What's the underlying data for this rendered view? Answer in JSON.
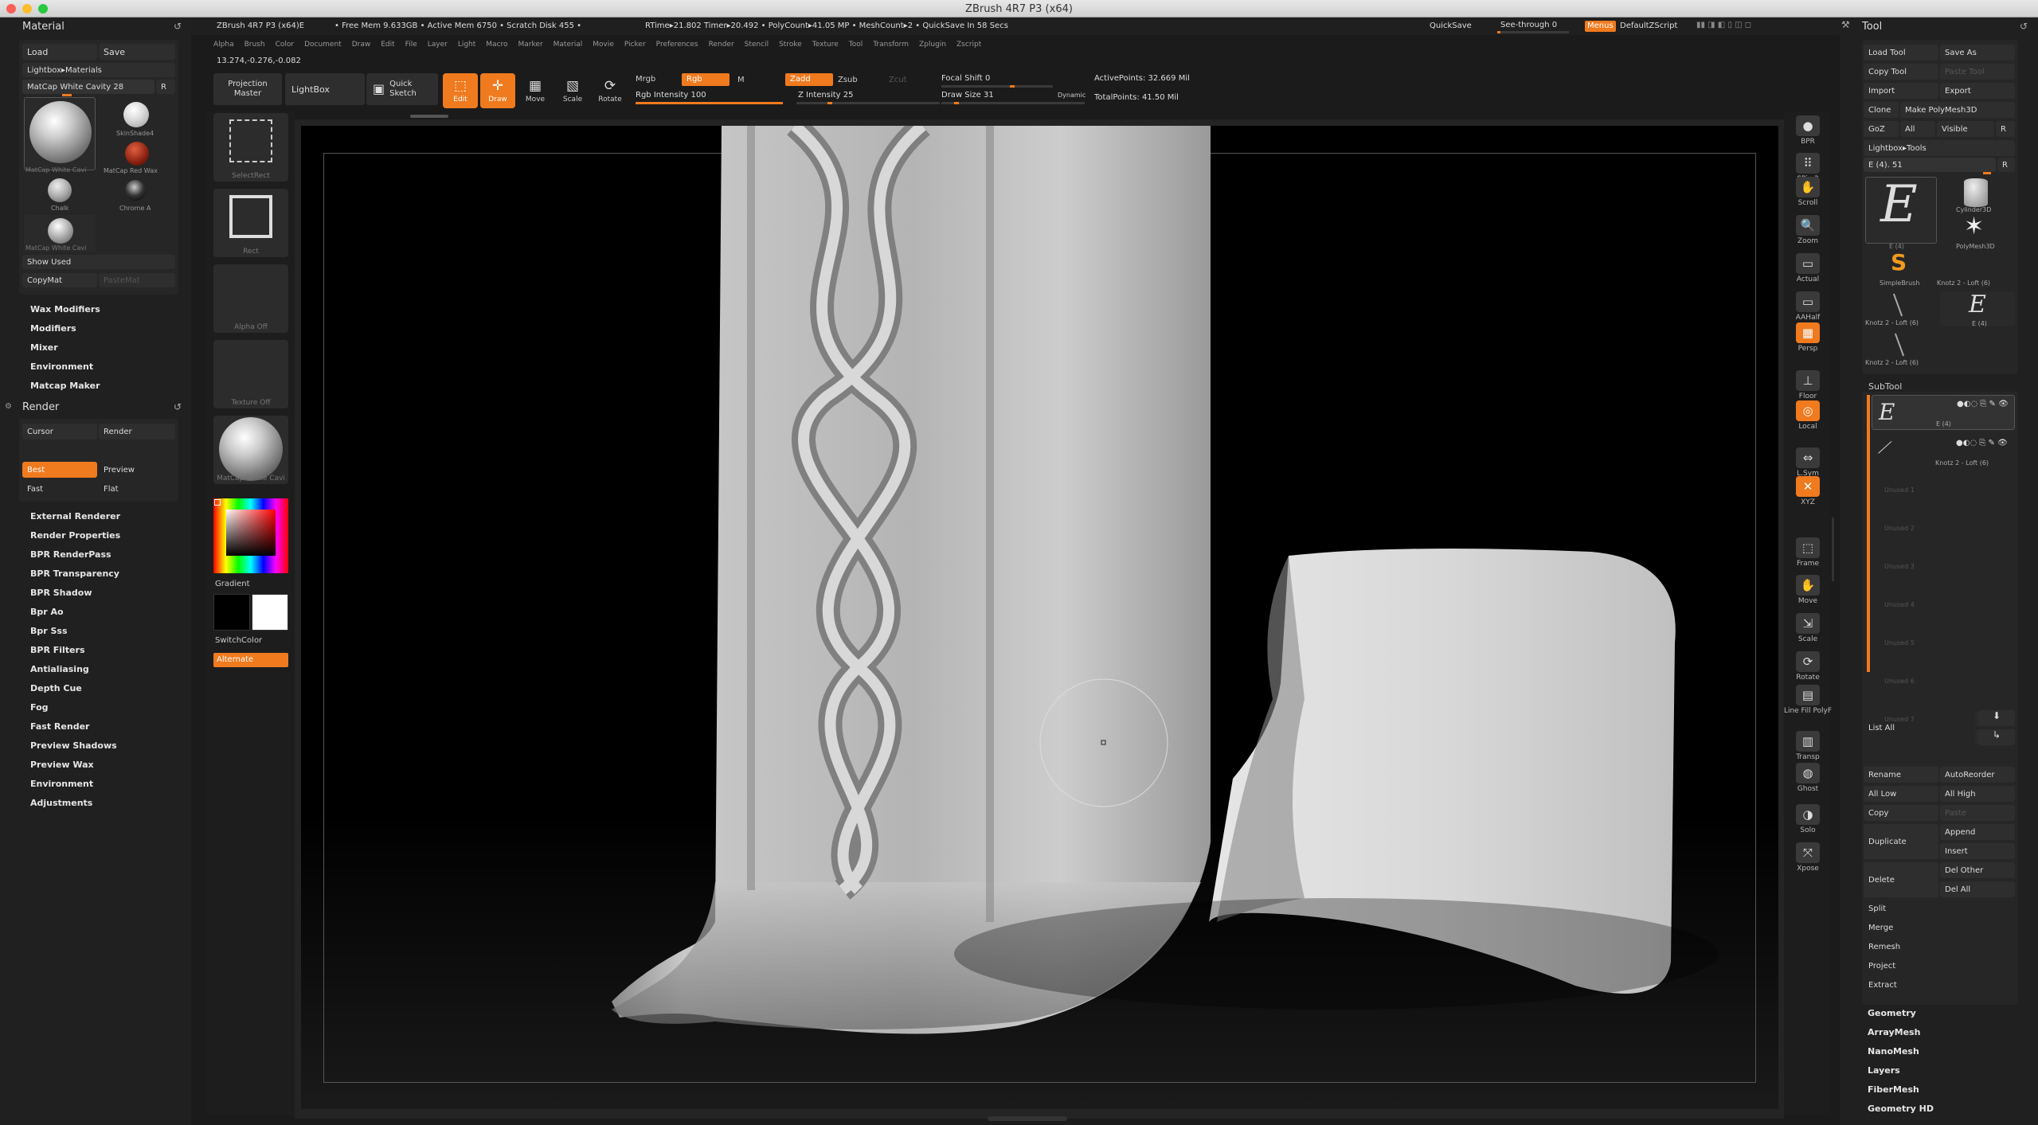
{
  "window": {
    "title": "ZBrush 4R7 P3 (x64)"
  },
  "status_bar": {
    "app": "ZBrush 4R7 P3 (x64)E",
    "free_mem": "• Free Mem 9.633GB • Active Mem 6750 • Scratch Disk 455 •",
    "rtime": "RTime▸21.802 Timer▸20.492 • PolyCount▸41.05 MP • MeshCount▸2 • QuickSave In 58 Secs",
    "quicksave": "QuickSave",
    "see_through": "See-through 0",
    "menus": "Menus",
    "default_zscript": "DefaultZScript"
  },
  "menubar": [
    "Alpha",
    "Brush",
    "Color",
    "Document",
    "Draw",
    "Edit",
    "File",
    "Layer",
    "Light",
    "Macro",
    "Marker",
    "Material",
    "Movie",
    "Picker",
    "Preferences",
    "Render",
    "Stencil",
    "Stroke",
    "Texture",
    "Tool",
    "Transform",
    "Zplugin",
    "Zscript"
  ],
  "coords": "13.274,-0.276,-0.082",
  "toolbar": {
    "projection_master": "Projection\nMaster",
    "lightbox": "LightBox",
    "quick_sketch": "Quick\nSketch",
    "edit": "Edit",
    "draw": "Draw",
    "move": "Move",
    "scale": "Scale",
    "rotate": "Rotate",
    "mrgb": "Mrgb",
    "rgb": "Rgb",
    "m": "M",
    "rgb_intensity": "Rgb Intensity 100",
    "zadd": "Zadd",
    "zsub": "Zsub",
    "zcut": "Zcut",
    "z_intensity": "Z Intensity 25",
    "focal_shift": "Focal Shift 0",
    "draw_size": "Draw Size 31",
    "dynamic": "Dynamic",
    "active_points": "ActivePoints: 32.669 Mil",
    "total_points": "TotalPoints: 41.50 Mil",
    "rgb_intensity_value": 100,
    "z_intensity_value": 25,
    "draw_size_value": 31
  },
  "material_panel": {
    "title": "Material",
    "load": "Load",
    "save": "Save",
    "lightbox_materials": "Lightbox▸Materials",
    "current": "MatCap White Cavity 28",
    "r": "R",
    "items": [
      "MatCap White Cavi",
      "SkinShade4",
      "MatCap Red Wax",
      "Chalk",
      "Chrome A",
      "MatCap White Cavi"
    ],
    "show_used": "Show Used",
    "copymat": "CopyMat",
    "pastemat": "PasteMat",
    "sub_menus": [
      "Wax Modifiers",
      "Modifiers",
      "Mixer",
      "Environment",
      "Matcap Maker"
    ]
  },
  "render_panel": {
    "title": "Render",
    "cursor": "Cursor",
    "render": "Render",
    "best": "Best",
    "preview": "Preview",
    "fast": "Fast",
    "flat": "Flat",
    "sub_menus": [
      "External Renderer",
      "Render Properties",
      "BPR RenderPass",
      "BPR Transparency",
      "BPR Shadow",
      "Bpr Ao",
      "Bpr Sss",
      "BPR Filters",
      "Antialiasing",
      "Depth Cue",
      "Fog",
      "Fast Render",
      "Preview Shadows",
      "Preview Wax",
      "Environment",
      "Adjustments"
    ]
  },
  "shelf": {
    "select_rect": "SelectRect",
    "rect": "Rect",
    "alpha_off": "Alpha Off",
    "texture_off": "Texture Off",
    "matcap": "MatCap White Cavi",
    "gradient": "Gradient",
    "switch_color": "SwitchColor",
    "alternate": "Alternate"
  },
  "right_shelf": [
    {
      "label": "BPR",
      "active": false
    },
    {
      "label": "SPix 3",
      "active": false
    },
    {
      "label": "Scroll",
      "active": false
    },
    {
      "label": "Zoom",
      "active": false
    },
    {
      "label": "Actual",
      "active": false
    },
    {
      "label": "AAHalf",
      "active": false
    },
    {
      "label": "Persp",
      "active": true
    },
    {
      "label": "Floor",
      "active": false
    },
    {
      "label": "Local",
      "active": true
    },
    {
      "label": "L.Sym",
      "active": false
    },
    {
      "label": "XYZ",
      "active": true
    },
    {
      "label": "Frame",
      "active": false
    },
    {
      "label": "Move",
      "active": false
    },
    {
      "label": "Scale",
      "active": false
    },
    {
      "label": "Rotate",
      "active": false
    },
    {
      "label": "Line Fill PolyF",
      "active": false
    },
    {
      "label": "Transp",
      "active": false
    },
    {
      "label": "Ghost",
      "active": false
    },
    {
      "label": "Solo",
      "active": false
    },
    {
      "label": "Xpose",
      "active": false
    }
  ],
  "tool_panel": {
    "title": "Tool",
    "load_tool": "Load Tool",
    "save_as": "Save As",
    "copy_tool": "Copy Tool",
    "paste_tool": "Paste Tool",
    "import": "Import",
    "export": "Export",
    "clone": "Clone",
    "make_polymesh": "Make PolyMesh3D",
    "goz": "GoZ",
    "all": "All",
    "visible": "Visible",
    "r": "R",
    "lightbox_tools": "Lightbox▸Tools",
    "current_tool": "E (4). 51",
    "thumbs": [
      "E (4)",
      "Cylinder3D",
      "PolyMesh3D",
      "SimpleBrush",
      "Knotz 2 - Loft (6)",
      "Knotz 2 - Loft (6)",
      "E (4)",
      "Knotz 2 - Loft (6)"
    ],
    "subtool_title": "SubTool",
    "subtools": [
      "E (4)",
      "Knotz 2 - Loft (6)",
      "Unused 1",
      "Unused 2",
      "Unused 3",
      "Unused 4",
      "Unused 5",
      "Unused 6",
      "Unused 7"
    ],
    "list_all": "List All",
    "rename": "Rename",
    "autoreorder": "AutoReorder",
    "all_low": "All Low",
    "all_high": "All High",
    "copy": "Copy",
    "paste": "Paste",
    "append": "Append",
    "duplicate": "Duplicate",
    "insert": "Insert",
    "del_other": "Del Other",
    "delete": "Delete",
    "del_all": "Del All",
    "split": "Split",
    "merge": "Merge",
    "remesh": "Remesh",
    "project": "Project",
    "extract": "Extract",
    "sub_menus": [
      "Geometry",
      "ArrayMesh",
      "NanoMesh",
      "Layers",
      "FiberMesh",
      "Geometry HD"
    ]
  }
}
